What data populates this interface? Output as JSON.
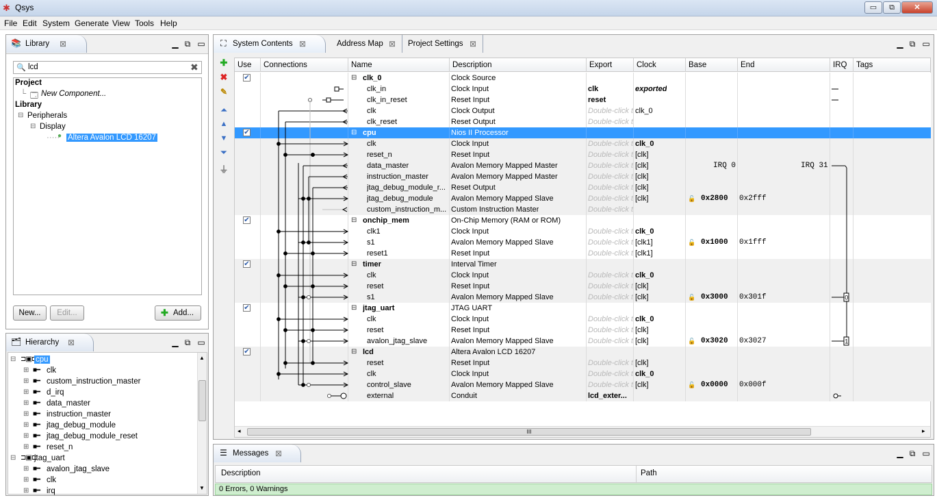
{
  "window": {
    "title": "Qsys",
    "minimize": "▭",
    "restore": "⧉",
    "close": "✕"
  },
  "menu": [
    "File",
    "Edit",
    "System",
    "Generate",
    "View",
    "Tools",
    "Help"
  ],
  "library": {
    "tab": "Library",
    "search": "lcd",
    "items": [
      "Project",
      "New Component...",
      "Library",
      "Peripherals",
      "Display",
      "Altera Avalon LCD 16207"
    ],
    "buttons": {
      "new": "New...",
      "edit": "Edit...",
      "add": "Add..."
    }
  },
  "hierarchy": {
    "tab": "Hierarchy",
    "items": [
      "cpu",
      "clk",
      "custom_instruction_master",
      "d_irq",
      "data_master",
      "instruction_master",
      "jtag_debug_module",
      "jtag_debug_module_reset",
      "reset_n",
      "jtag_uart",
      "avalon_jtag_slave",
      "clk",
      "irq"
    ]
  },
  "tabs": [
    "System Contents",
    "Address Map",
    "Project Settings"
  ],
  "columns": [
    "Use",
    "Connections",
    "Name",
    "Description",
    "Export",
    "Clock",
    "Base",
    "End",
    "IRQ",
    "Tags"
  ],
  "rows": [
    {
      "name": "clk_0",
      "desc": "Clock Source",
      "export": "",
      "clock": "",
      "base": "",
      "end": "",
      "top": true,
      "use": true
    },
    {
      "name": "clk_in",
      "desc": "Clock Input",
      "export": "clk",
      "clock": "exported",
      "base": "",
      "end": ""
    },
    {
      "name": "clk_in_reset",
      "desc": "Reset Input",
      "export": "reset",
      "clock": "",
      "base": "",
      "end": ""
    },
    {
      "name": "clk",
      "desc": "Clock Output",
      "export": "Double-click to export",
      "clock": "clk_0",
      "base": "",
      "end": ""
    },
    {
      "name": "clk_reset",
      "desc": "Reset Output",
      "export": "Double-click to export",
      "clock": "",
      "base": "",
      "end": ""
    },
    {
      "name": "cpu",
      "desc": "Nios II Processor",
      "export": "",
      "clock": "",
      "base": "",
      "end": "",
      "top": true,
      "use": true,
      "sel": true
    },
    {
      "name": "clk",
      "desc": "Clock Input",
      "export": "Double-click to export",
      "clock": "clk_0",
      "base": "",
      "end": ""
    },
    {
      "name": "reset_n",
      "desc": "Reset Input",
      "export": "Double-click to export",
      "clock": "[clk]",
      "base": "",
      "end": ""
    },
    {
      "name": "data_master",
      "desc": "Avalon Memory Mapped Master",
      "export": "Double-click to export",
      "clock": "[clk]",
      "base": "IRQ 0",
      "end": "IRQ 31"
    },
    {
      "name": "instruction_master",
      "desc": "Avalon Memory Mapped Master",
      "export": "Double-click to export",
      "clock": "[clk]",
      "base": "",
      "end": ""
    },
    {
      "name": "jtag_debug_module_r...",
      "desc": "Reset Output",
      "export": "Double-click to export",
      "clock": "[clk]",
      "base": "",
      "end": ""
    },
    {
      "name": "jtag_debug_module",
      "desc": "Avalon Memory Mapped Slave",
      "export": "Double-click to export",
      "clock": "[clk]",
      "base": "0x2800",
      "end": "0x2fff"
    },
    {
      "name": "custom_instruction_m...",
      "desc": "Custom Instruction Master",
      "export": "Double-click to export",
      "clock": "",
      "base": "",
      "end": ""
    },
    {
      "name": "onchip_mem",
      "desc": "On-Chip Memory (RAM or ROM)",
      "export": "",
      "clock": "",
      "base": "",
      "end": "",
      "top": true,
      "use": true
    },
    {
      "name": "clk1",
      "desc": "Clock Input",
      "export": "Double-click to export",
      "clock": "clk_0",
      "base": "",
      "end": ""
    },
    {
      "name": "s1",
      "desc": "Avalon Memory Mapped Slave",
      "export": "Double-click to export",
      "clock": "[clk1]",
      "base": "0x1000",
      "end": "0x1fff"
    },
    {
      "name": "reset1",
      "desc": "Reset Input",
      "export": "Double-click to export",
      "clock": "[clk1]",
      "base": "",
      "end": ""
    },
    {
      "name": "timer",
      "desc": "Interval Timer",
      "export": "",
      "clock": "",
      "base": "",
      "end": "",
      "top": true,
      "use": true
    },
    {
      "name": "clk",
      "desc": "Clock Input",
      "export": "Double-click to export",
      "clock": "clk_0",
      "base": "",
      "end": ""
    },
    {
      "name": "reset",
      "desc": "Reset Input",
      "export": "Double-click to export",
      "clock": "[clk]",
      "base": "",
      "end": ""
    },
    {
      "name": "s1",
      "desc": "Avalon Memory Mapped Slave",
      "export": "Double-click to export",
      "clock": "[clk]",
      "base": "0x3000",
      "end": "0x301f",
      "irq": "0"
    },
    {
      "name": "jtag_uart",
      "desc": "JTAG UART",
      "export": "",
      "clock": "",
      "base": "",
      "end": "",
      "top": true,
      "use": true
    },
    {
      "name": "clk",
      "desc": "Clock Input",
      "export": "Double-click to export",
      "clock": "clk_0",
      "base": "",
      "end": ""
    },
    {
      "name": "reset",
      "desc": "Reset Input",
      "export": "Double-click to export",
      "clock": "[clk]",
      "base": "",
      "end": ""
    },
    {
      "name": "avalon_jtag_slave",
      "desc": "Avalon Memory Mapped Slave",
      "export": "Double-click to export",
      "clock": "[clk]",
      "base": "0x3020",
      "end": "0x3027",
      "irq": "1"
    },
    {
      "name": "lcd",
      "desc": "Altera Avalon LCD 16207",
      "export": "",
      "clock": "",
      "base": "",
      "end": "",
      "top": true,
      "use": true
    },
    {
      "name": "reset",
      "desc": "Reset Input",
      "export": "Double-click to export",
      "clock": "[clk]",
      "base": "",
      "end": ""
    },
    {
      "name": "clk",
      "desc": "Clock Input",
      "export": "Double-click to export",
      "clock": "clk_0",
      "base": "",
      "end": ""
    },
    {
      "name": "control_slave",
      "desc": "Avalon Memory Mapped Slave",
      "export": "Double-click to export",
      "clock": "[clk]",
      "base": "0x0000",
      "end": "0x000f"
    },
    {
      "name": "external",
      "desc": "Conduit",
      "export": "lcd_exter...",
      "clock": "",
      "base": "",
      "end": ""
    }
  ],
  "hscroll": "III",
  "messages": {
    "tab": "Messages",
    "col_desc": "Description",
    "col_path": "Path",
    "status": "0 Errors, 0 Warnings"
  }
}
